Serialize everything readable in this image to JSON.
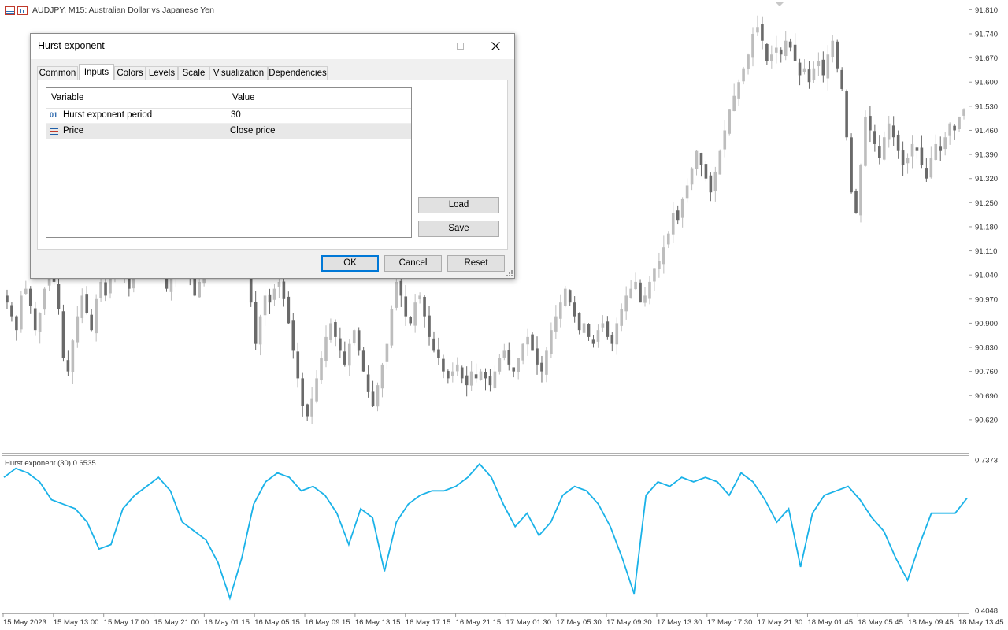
{
  "chart": {
    "symbol_icons": [
      "grid-table-icon",
      "bar-chart-icon"
    ],
    "title": "AUDJPY, M15:  Australian Dollar vs Japanese Yen",
    "price_axis": [
      "91.810",
      "91.740",
      "91.670",
      "91.600",
      "91.530",
      "91.460",
      "91.390",
      "91.320",
      "91.250",
      "91.180",
      "91.110",
      "91.040",
      "90.970",
      "90.900",
      "90.830",
      "90.760",
      "90.690",
      "90.620"
    ],
    "indicator_label": "Hurst exponent (30) 0.6535",
    "indicator_axis": [
      "0.7373",
      "0.4048"
    ],
    "time_axis": [
      "15 May 2023",
      "15 May 13:00",
      "15 May 17:00",
      "15 May 21:00",
      "16 May 01:15",
      "16 May 05:15",
      "16 May 09:15",
      "16 May 13:15",
      "16 May 17:15",
      "16 May 21:15",
      "17 May 01:30",
      "17 May 05:30",
      "17 May 09:30",
      "17 May 13:30",
      "17 May 17:30",
      "17 May 21:30",
      "18 May 01:45",
      "18 May 05:45",
      "18 May 09:45",
      "18 May 13:45"
    ],
    "colors": {
      "bull": "#bdbdbd",
      "bear": "#6a6a6a",
      "indicator": "#1ab2e8"
    }
  },
  "chart_data": [
    {
      "type": "candlestick",
      "title": "AUDJPY, M15:  Australian Dollar vs Japanese Yen",
      "ylim": [
        90.59,
        91.82
      ],
      "yticks": [
        91.81,
        91.74,
        91.67,
        91.6,
        91.53,
        91.46,
        91.39,
        91.32,
        91.25,
        91.18,
        91.11,
        91.04,
        90.97,
        90.9,
        90.83,
        90.76,
        90.69,
        90.62
      ],
      "closes": [
        90.96,
        90.92,
        90.88,
        90.98,
        91.0,
        90.95,
        90.88,
        90.93,
        91.0,
        91.05,
        91.02,
        90.94,
        90.8,
        90.76,
        90.85,
        90.92,
        90.98,
        90.93,
        90.88,
        90.97,
        91.02,
        90.98,
        91.05,
        91.08,
        91.1,
        91.05,
        91.0,
        91.08,
        91.12,
        91.1,
        91.14,
        91.18,
        91.12,
        91.06,
        91.0,
        91.03,
        91.08,
        91.12,
        91.1,
        91.04,
        90.98,
        91.02,
        91.06,
        91.1,
        91.14,
        91.16,
        91.12,
        91.08,
        91.06,
        91.1,
        91.12,
        91.08,
        90.96,
        90.84,
        90.92,
        90.98,
        90.96,
        91.0,
        91.02,
        90.97,
        90.9,
        90.82,
        90.74,
        90.66,
        90.63,
        90.68,
        90.74,
        90.8,
        90.86,
        90.9,
        90.86,
        90.82,
        90.78,
        90.84,
        90.88,
        90.82,
        90.76,
        90.7,
        90.66,
        90.72,
        90.78,
        90.84,
        90.94,
        91.02,
        90.98,
        90.92,
        90.9,
        90.96,
        90.98,
        90.92,
        90.86,
        90.82,
        90.8,
        90.76,
        90.74,
        90.76,
        90.78,
        90.74,
        90.72,
        90.76,
        90.74,
        90.76,
        90.74,
        90.72,
        90.76,
        90.8,
        90.82,
        90.78,
        90.76,
        90.8,
        90.84,
        90.86,
        90.82,
        90.78,
        90.76,
        90.82,
        90.88,
        90.92,
        90.96,
        91.0,
        90.96,
        90.92,
        90.88,
        90.9,
        90.86,
        90.84,
        90.88,
        90.9,
        90.86,
        90.84,
        90.9,
        90.94,
        90.98,
        91.0,
        91.02,
        90.96,
        90.98,
        91.02,
        91.06,
        91.08,
        91.12,
        91.16,
        91.22,
        91.2,
        91.26,
        91.3,
        91.35,
        91.4,
        91.36,
        91.32,
        91.28,
        91.34,
        91.4,
        91.46,
        91.52,
        91.56,
        91.6,
        91.64,
        91.68,
        91.74,
        91.76,
        91.72,
        91.66,
        91.68,
        91.7,
        91.68,
        91.72,
        91.7,
        91.66,
        91.62,
        91.64,
        91.6,
        91.64,
        91.66,
        91.62,
        91.68,
        91.72,
        91.64,
        91.58,
        91.44,
        91.28,
        91.22,
        91.36,
        91.5,
        91.46,
        91.42,
        91.38,
        91.44,
        91.48,
        91.44,
        91.4,
        91.36,
        91.38,
        91.42,
        91.4,
        91.36,
        91.32,
        91.38,
        91.42,
        91.4,
        91.44,
        91.48,
        91.46,
        91.5,
        91.52
      ]
    },
    {
      "type": "line",
      "title": "Hurst exponent (30) 0.6535",
      "ylim": [
        0.4048,
        0.7373
      ],
      "x": [
        "15 May 2023",
        "15 May 13:00",
        "15 May 17:00",
        "15 May 21:00",
        "16 May 01:15",
        "16 May 05:15",
        "16 May 09:15",
        "16 May 13:15",
        "16 May 17:15",
        "16 May 21:15",
        "17 May 01:30",
        "17 May 05:30",
        "17 May 09:30",
        "17 May 13:30",
        "17 May 17:30",
        "17 May 21:30",
        "18 May 01:45",
        "18 May 05:45",
        "18 May 09:45",
        "18 May 13:45"
      ],
      "series": [
        {
          "name": "Hurst exponent (30)",
          "values": [
            0.7,
            0.72,
            0.71,
            0.69,
            0.65,
            0.64,
            0.63,
            0.6,
            0.54,
            0.55,
            0.63,
            0.66,
            0.68,
            0.7,
            0.67,
            0.6,
            0.58,
            0.56,
            0.51,
            0.43,
            0.52,
            0.64,
            0.69,
            0.71,
            0.7,
            0.67,
            0.68,
            0.66,
            0.62,
            0.55,
            0.63,
            0.61,
            0.49,
            0.6,
            0.64,
            0.66,
            0.67,
            0.67,
            0.68,
            0.7,
            0.73,
            0.7,
            0.64,
            0.59,
            0.62,
            0.57,
            0.6,
            0.66,
            0.68,
            0.67,
            0.64,
            0.59,
            0.52,
            0.44,
            0.66,
            0.69,
            0.68,
            0.7,
            0.69,
            0.7,
            0.69,
            0.66,
            0.71,
            0.69,
            0.65,
            0.6,
            0.63,
            0.5,
            0.62,
            0.66,
            0.67,
            0.68,
            0.65,
            0.61,
            0.58,
            0.52,
            0.47,
            0.55,
            0.62,
            0.62,
            0.62,
            0.6535
          ]
        }
      ]
    }
  ],
  "dialog": {
    "title": "Hurst exponent",
    "icons": [
      "minimize-icon",
      "maximize-icon",
      "close-icon",
      "resize-grip-icon"
    ],
    "tabs": [
      "Common",
      "Inputs",
      "Colors",
      "Levels",
      "Scale",
      "Visualization",
      "Dependencies"
    ],
    "active_tab": "Inputs",
    "grid": {
      "headers": [
        "Variable",
        "Value"
      ],
      "rows": [
        {
          "icon": "integer-type-icon",
          "icon_text": "01",
          "variable": "Hurst exponent period",
          "value": "30"
        },
        {
          "icon": "enum-type-icon",
          "variable": "Price",
          "value": "Close price"
        }
      ]
    },
    "side_buttons": {
      "load": "Load",
      "save": "Save"
    },
    "buttons": {
      "ok": "OK",
      "cancel": "Cancel",
      "reset": "Reset"
    }
  }
}
